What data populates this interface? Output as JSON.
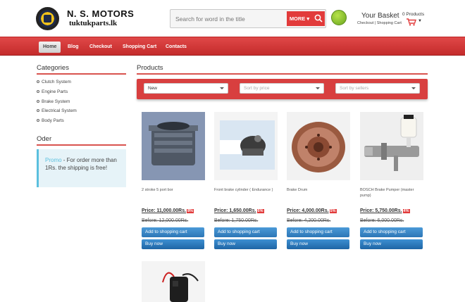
{
  "header": {
    "brand_title": "N. S. MOTORS",
    "brand_subtitle": "tuktukparts.lk",
    "search_placeholder": "Search for word in the title",
    "more_label": "MORE",
    "basket_title": "Your Basket",
    "basket_links": "Checkout | Shopping Cart",
    "basket_count": "0 Products"
  },
  "nav": {
    "items": [
      {
        "label": "Home",
        "active": true
      },
      {
        "label": "Blog"
      },
      {
        "label": "Checkout"
      },
      {
        "label": "Shopping Cart"
      },
      {
        "label": "Contacts"
      }
    ]
  },
  "sidebar": {
    "categories_title": "Categories",
    "categories": [
      "Clutch System",
      "Engine Parts",
      "Brake System",
      "Electrical System",
      "Body Parts"
    ],
    "order_title": "Oder",
    "promo_label": "Promo",
    "promo_text": " - For order more than 1Rs. the shipping is free!"
  },
  "products_section": {
    "title": "Products",
    "filters": {
      "sort_new": "New",
      "sort_price": "Sort by price",
      "sort_sellers": "Sort by sellers"
    },
    "add_to_cart_label": "Add to shopping cart",
    "buy_now_label": "Buy now",
    "items": [
      {
        "name": "2 stroke 5 port bor",
        "price": "Price: 11,000.00Rs.",
        "discount": "8%",
        "before": "Before: 12,000.00Rs."
      },
      {
        "name": "Front brake cylinder ( Endurance )",
        "price": "Price: 1,650.00Rs.",
        "discount": "6%",
        "before": "Before: 1,750.00Rs."
      },
      {
        "name": "Brake Drum",
        "price": "Price: 4,000.00Rs.",
        "discount": "5%",
        "before": "Before: 4,200.00Rs."
      },
      {
        "name": "BOSCH Brake Pumper (master pump)",
        "price": "Price: 5,750.00Rs.",
        "discount": "4%",
        "before": "Before: 6,000.00Rs."
      }
    ]
  },
  "colors": {
    "accent_red": "#d83f3f",
    "button_blue": "#2c76b6",
    "promo_blue": "#5bc0de"
  }
}
